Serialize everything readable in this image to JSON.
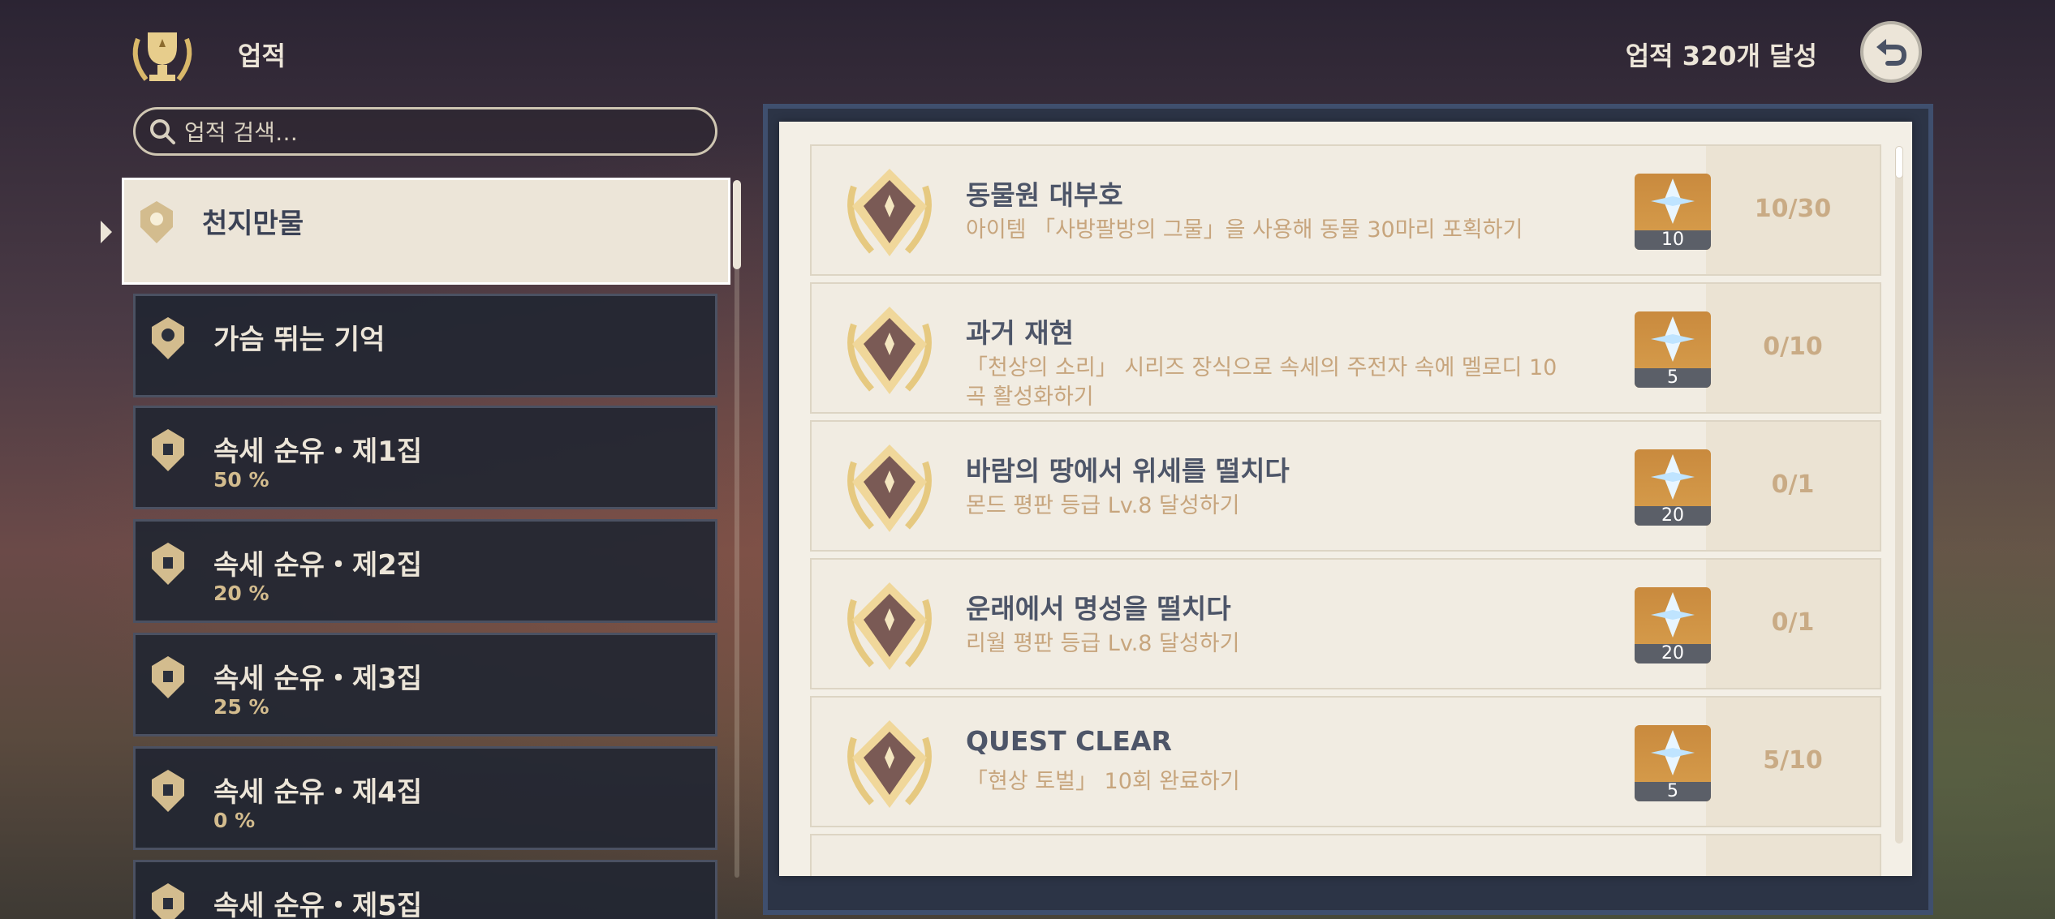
{
  "header": {
    "title": "업적",
    "achievement_count": "업적 320개 달성"
  },
  "search": {
    "placeholder": "업적 검색…"
  },
  "categories": [
    {
      "name": "천지만물",
      "percent": ""
    },
    {
      "name": "가슴 뛰는 기억",
      "percent": ""
    },
    {
      "name": "속세 순유・제1집",
      "percent": "50 %"
    },
    {
      "name": "속세 순유・제2집",
      "percent": "20 %"
    },
    {
      "name": "속세 순유・제3집",
      "percent": "25 %"
    },
    {
      "name": "속세 순유・제4집",
      "percent": "0 %"
    },
    {
      "name": "속세 순유・제5집",
      "percent": ""
    }
  ],
  "achievements": [
    {
      "title": "동물원 대부호",
      "desc": "아이템 「사방팔방의 그물」을 사용해 동물 30마리 포획하기",
      "reward": "10",
      "progress": "10/30"
    },
    {
      "title": "과거 재현",
      "desc": "「천상의 소리」 시리즈 장식으로 속세의 주전자 속에 멜로디 10곡 활성화하기",
      "reward": "5",
      "progress": "0/10"
    },
    {
      "title": "바람의 땅에서 위세를 떨치다",
      "desc": "몬드 평판 등급 Lv.8 달성하기",
      "reward": "20",
      "progress": "0/1"
    },
    {
      "title": "운래에서 명성을 떨치다",
      "desc": "리월 평판 등급 Lv.8 달성하기",
      "reward": "20",
      "progress": "0/1"
    },
    {
      "title": "QUEST CLEAR",
      "desc": "「현상 토벌」 10회 완료하기",
      "reward": "5",
      "progress": "5/10"
    }
  ],
  "colors": {
    "accent_gold": "#d3bc8e",
    "panel_dark": "#222632",
    "paper": "#f3efe6"
  }
}
